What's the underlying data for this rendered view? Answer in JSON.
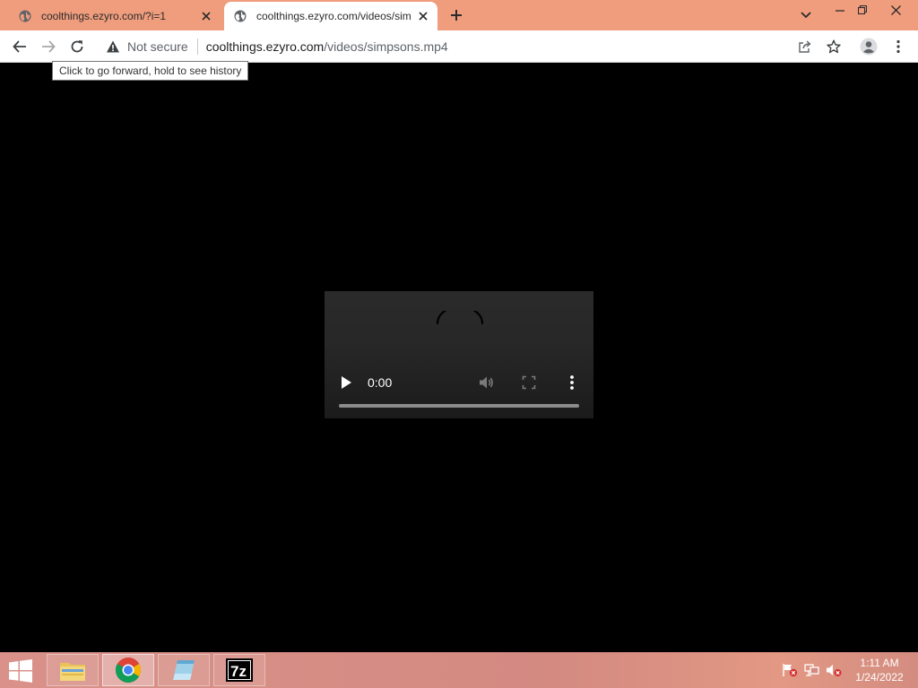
{
  "browser": {
    "tabs": [
      {
        "title": "coolthings.ezyro.com/?i=1",
        "active": false,
        "icon": "globe-icon"
      },
      {
        "title": "coolthings.ezyro.com/videos/sim",
        "active": true,
        "icon": "globe-icon"
      }
    ],
    "new_tab_icon": "plus-icon",
    "window_controls": [
      "chevron-down-icon",
      "minimize-icon",
      "restore-icon",
      "close-icon"
    ],
    "toolbar": {
      "back_icon": "back-arrow-icon",
      "forward_icon": "forward-arrow-icon",
      "reload_icon": "reload-icon",
      "security_text": "Not secure",
      "url_host": "coolthings.ezyro.com",
      "url_path": "/videos/simpsons.mp4",
      "share_icon": "share-icon",
      "bookmark_icon": "star-icon",
      "profile_icon": "profile-icon",
      "menu_icon": "kebab-menu-icon"
    },
    "tooltip": "Click to go forward, hold to see history"
  },
  "video_player": {
    "time": "0:00",
    "progress": 0,
    "icons": [
      "play-icon",
      "volume-icon",
      "fullscreen-icon",
      "more-options-icon"
    ]
  },
  "taskbar": {
    "apps": [
      "file-explorer-icon",
      "chrome-icon",
      "notepad-icon",
      "7zip-icon"
    ],
    "tray": [
      "action-center-flag-icon",
      "network-icon",
      "volume-muted-icon"
    ],
    "clock": {
      "time": "1:11 AM",
      "date": "1/24/2022"
    }
  },
  "colors": {
    "tab_strip": "#f09d7e",
    "page_background": "#000000",
    "taskbar": "#d38a81"
  }
}
